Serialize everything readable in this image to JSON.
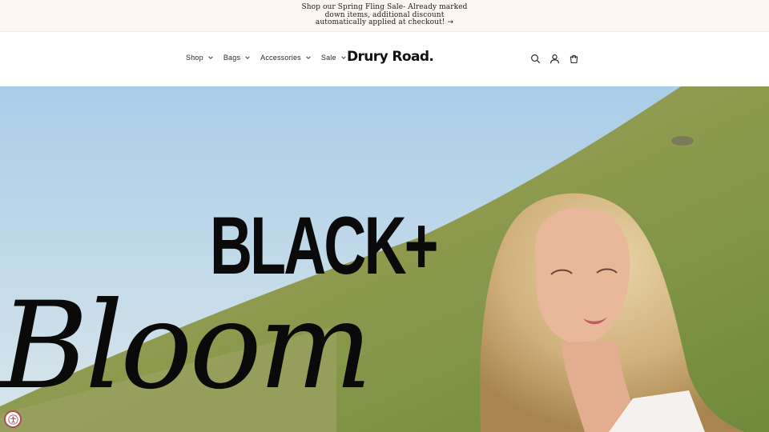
{
  "announcement": {
    "text": "Shop our Spring Fling Sale- Already marked down items, additional discount automatically applied at checkout!",
    "arrow": "→"
  },
  "header": {
    "nav": [
      {
        "label": "Shop"
      },
      {
        "label": "Bags"
      },
      {
        "label": "Accessories"
      },
      {
        "label": "Sale"
      }
    ],
    "logo": "Drury Road.",
    "icons": [
      "search-icon",
      "account-icon",
      "cart-icon"
    ]
  },
  "hero": {
    "headline": "BLACK+",
    "script": "Bloom"
  },
  "accessibility": {
    "icon": "accessibility-icon",
    "color": "#b04a5a"
  },
  "colors": {
    "announcement_bg": "#fdf6f1",
    "sky": "#b9d6ea",
    "hill": "#8e9a52"
  }
}
